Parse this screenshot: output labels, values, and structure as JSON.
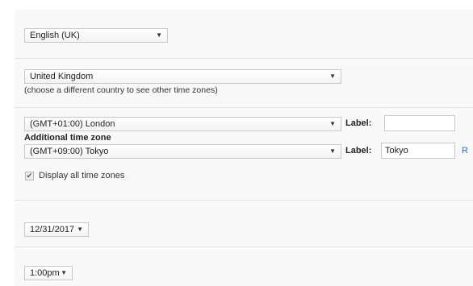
{
  "language": {
    "selected": "English (UK)"
  },
  "country": {
    "selected": "United Kingdom",
    "hint": "(choose a different country to see other time zones)"
  },
  "timezone": {
    "primary": "(GMT+01:00) London",
    "label_text": "Label:",
    "primary_label_value": "",
    "additional_heading": "Additional time zone",
    "additional": "(GMT+09:00) Tokyo",
    "additional_label_value": "Tokyo",
    "cut_link": "R",
    "display_all_label": "Display all time zones",
    "display_all_checked": true
  },
  "date": {
    "selected": "12/31/2017"
  },
  "time": {
    "selected": "1:00pm"
  },
  "icons": {
    "dropdown": "chevron-down-icon",
    "check": "checkmark-icon"
  },
  "colors": {
    "panel_bg": "#f9f9f9",
    "divider": "#e3e3e3",
    "link": "#2a6ac9"
  }
}
